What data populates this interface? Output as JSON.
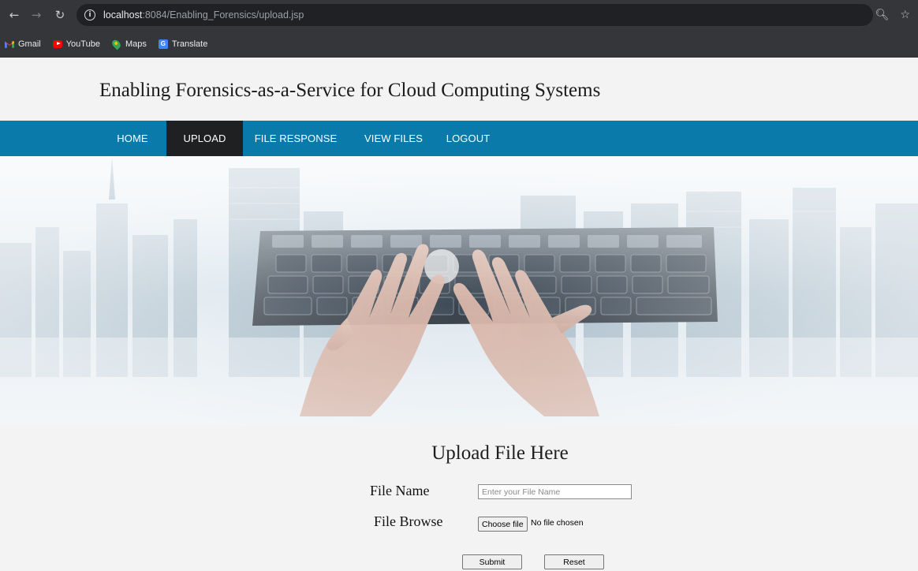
{
  "browser": {
    "url_host": "localhost",
    "url_rest": ":8084/Enabling_Forensics/upload.jsp",
    "bookmarks": [
      {
        "label": "Gmail",
        "icon": "gmail-icon"
      },
      {
        "label": "YouTube",
        "icon": "youtube-icon"
      },
      {
        "label": "Maps",
        "icon": "maps-icon"
      },
      {
        "label": "Translate",
        "icon": "translate-icon"
      }
    ]
  },
  "site": {
    "title": "Enabling Forensics-as-a-Service for Cloud Computing Systems"
  },
  "menu": {
    "items": [
      {
        "label": "HOME",
        "active": false
      },
      {
        "label": "UPLOAD",
        "active": true
      },
      {
        "label": "FILE RESPONSE",
        "active": false
      },
      {
        "label": "VIEW FILES",
        "active": false
      },
      {
        "label": "LOGOUT",
        "active": false
      }
    ]
  },
  "banner": {
    "description_icon": "hands-typing-keyboard-city-image"
  },
  "form": {
    "title": "Upload File Here",
    "file_name_label": "File Name",
    "file_name_placeholder": "Enter your File Name",
    "file_name_value": "",
    "file_browse_label": "File Browse",
    "choose_file_label": "Choose file",
    "file_status": "No file chosen",
    "submit_label": "Submit",
    "reset_label": "Reset"
  },
  "colors": {
    "menu_bg": "#0a7aab",
    "menu_active_bg": "#1e2022",
    "chrome_bg": "#35363a",
    "page_bg": "#f3f3f3"
  }
}
